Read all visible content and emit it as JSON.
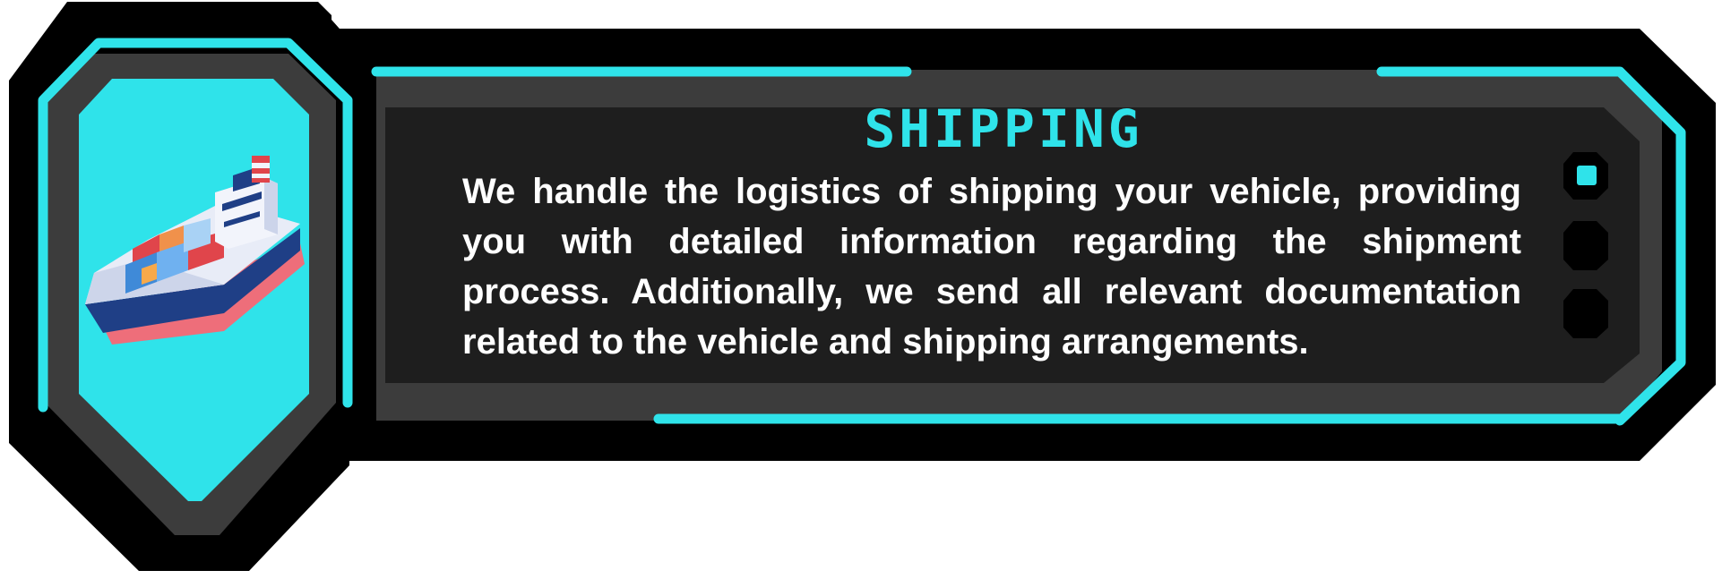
{
  "card": {
    "title": "SHIPPING",
    "description": "We handle the logistics of shipping your vehicle, providing you with detailed information regarding the shipment process. Additionally, we send all relevant documentation related to the vehicle and shipping arrangements.",
    "icon": "cargo-ship-icon",
    "pager": {
      "active_index": 0,
      "count": 3
    }
  },
  "colors": {
    "accent": "#2fe3ea",
    "outer": "#000000",
    "ring": "#3c3c3c",
    "panel": "#1e1e1e",
    "text": "#ffffff"
  }
}
